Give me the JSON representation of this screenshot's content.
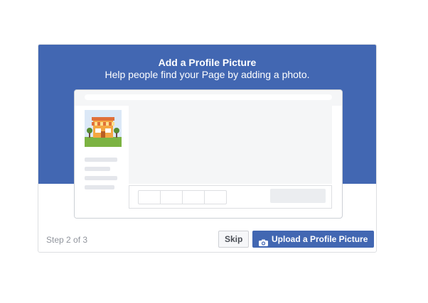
{
  "dialog": {
    "title": "Add a Profile Picture",
    "subtitle": "Help people find your Page by adding a photo.",
    "step_label": "Step 2 of 3",
    "skip_label": "Skip",
    "upload_label": "Upload a Profile Picture",
    "upload_icon": "camera-icon",
    "colors": {
      "header": "#4267b2",
      "button_primary": "#4267b2"
    }
  }
}
